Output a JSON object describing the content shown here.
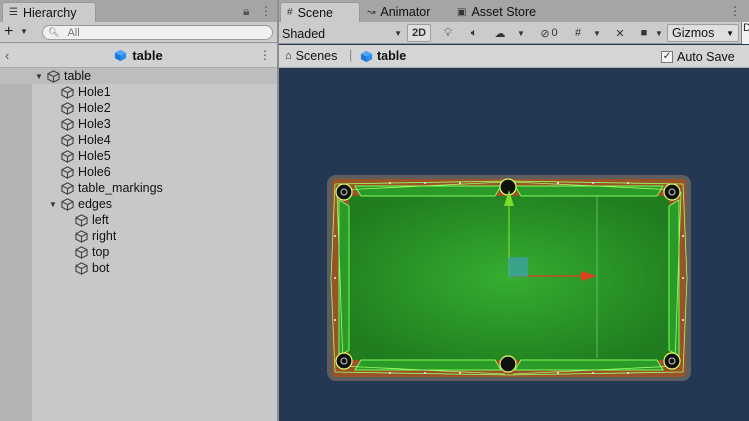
{
  "hierarchy": {
    "tab_label": "Hierarchy",
    "add_label": "+",
    "search_placeholder": "All",
    "scene_title": "table",
    "items": [
      {
        "label": "table"
      },
      {
        "label": "Hole1"
      },
      {
        "label": "Hole2"
      },
      {
        "label": "Hole3"
      },
      {
        "label": "Hole4"
      },
      {
        "label": "Hole5"
      },
      {
        "label": "Hole6"
      },
      {
        "label": "table_markings"
      },
      {
        "label": "edges"
      },
      {
        "label": "left"
      },
      {
        "label": "right"
      },
      {
        "label": "top"
      },
      {
        "label": "bot"
      }
    ]
  },
  "scene_view": {
    "tabs": [
      {
        "label": "Scene",
        "icon": "grid-icon"
      },
      {
        "label": "Animator",
        "icon": "animator-icon"
      },
      {
        "label": "Asset Store",
        "icon": "bag-icon"
      }
    ],
    "shading_mode": "Shaded",
    "mode_2d_label": "2D",
    "hidden_count": "0",
    "gizmos_label": "Gizmos",
    "edge_label": "D",
    "breadcrumb": {
      "root": "Scenes",
      "current": "table"
    },
    "auto_save_label": "Auto Save",
    "auto_save_checked": true
  },
  "colors": {
    "scene_bg": "#243753",
    "felt": "#2f9a2d",
    "wood": "#9a5328",
    "cushion_outline": "#7cff5a",
    "selection_outline": "#dfff6a",
    "x_axis": "#e0401e",
    "y_axis": "#7ddc2a"
  }
}
